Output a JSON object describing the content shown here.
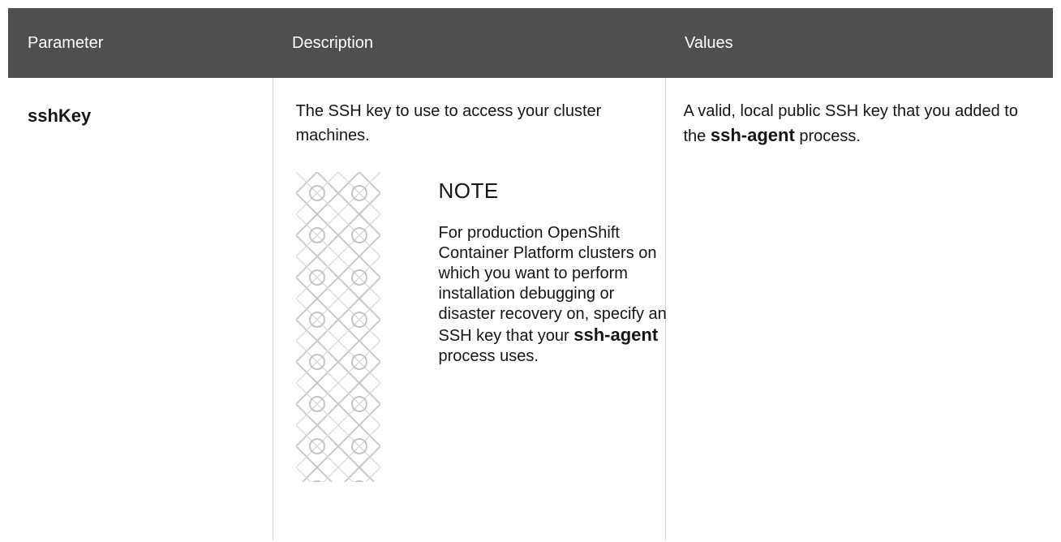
{
  "table": {
    "headers": {
      "parameter": "Parameter",
      "description": "Description",
      "values": "Values"
    },
    "row": {
      "parameter": "sshKey",
      "description": "The SSH key to use to access your cluster machines.",
      "note": {
        "title": "NOTE",
        "text_before": "For production OpenShift Container Platform clusters on which you want to perform installation debugging or disaster recovery on, specify an SSH key that your ",
        "command": "ssh-agent",
        "text_after": " process uses.",
        "icon": "note-pattern-icon"
      },
      "values": {
        "text_before": "A valid, local public SSH key that you added to the ",
        "command": "ssh-agent",
        "text_after": " process."
      }
    }
  }
}
